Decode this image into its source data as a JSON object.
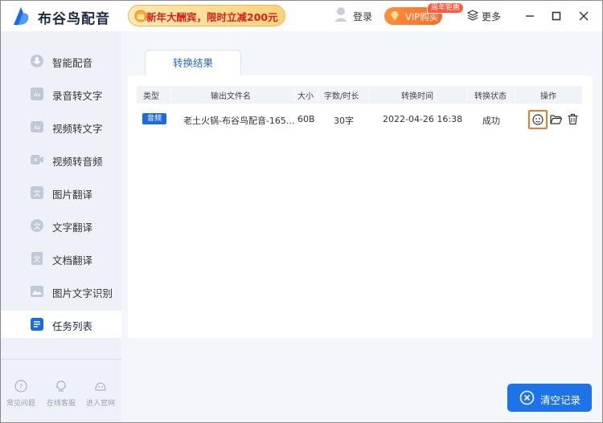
{
  "app": {
    "title": "布谷鸟配音",
    "promo_text": "新年大酬宾，限时立减200元",
    "login_label": "登录",
    "vip_label": "VIP购买",
    "vip_badge": "周年钜惠",
    "more_label": "更多"
  },
  "sidebar": {
    "items": [
      {
        "label": "智能配音",
        "icon": "mic-icon"
      },
      {
        "label": "录音转文字",
        "icon": "audio-to-text-icon"
      },
      {
        "label": "视频转文字",
        "icon": "video-to-text-icon"
      },
      {
        "label": "视频转音频",
        "icon": "video-to-audio-icon"
      },
      {
        "label": "图片翻译",
        "icon": "image-translate-icon"
      },
      {
        "label": "文字翻译",
        "icon": "text-translate-icon"
      },
      {
        "label": "文档翻译",
        "icon": "document-translate-icon"
      },
      {
        "label": "图片文字识别",
        "icon": "ocr-icon"
      },
      {
        "label": "任务列表",
        "icon": "task-list-icon",
        "active": true
      }
    ],
    "footer": [
      {
        "label": "常见问题",
        "icon": "help-icon"
      },
      {
        "label": "在线客服",
        "icon": "customer-service-icon"
      },
      {
        "label": "进入官网",
        "icon": "website-icon"
      }
    ]
  },
  "main": {
    "tab_label": "转换结果",
    "table": {
      "headers": [
        "类型",
        "输出文件名",
        "大小",
        "字数/时长",
        "转换时间",
        "转换状态",
        "操作"
      ],
      "rows": [
        {
          "type": "音频",
          "filename": "老土火锅-布谷鸟配音-165...",
          "size": "60B",
          "length": "30字",
          "time": "2022-04-26 16:38",
          "status": "成功"
        }
      ]
    },
    "clear_label": "清空记录"
  },
  "colors": {
    "accent": "#1d74e8",
    "highlight": "#f07a2a",
    "promo_text": "#d6221b"
  }
}
